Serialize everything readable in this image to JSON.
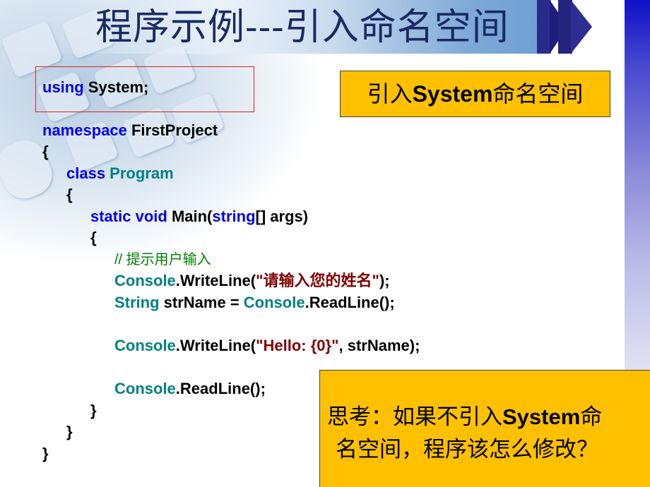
{
  "slide": {
    "title": "程序示例---引入命名空间",
    "callouts": {
      "import_note": {
        "prefix": "引入",
        "keyword": "System",
        "suffix": "命名空间"
      },
      "question": {
        "line1_prefix": "思考：如果不引入",
        "line1_keyword": "System",
        "line1_suffix": "命",
        "line2": "名空间，程序该怎么修改？"
      }
    },
    "code": {
      "using_kw": "using",
      "using_rest": " System;",
      "namespace_kw": "namespace",
      "namespace_name": " FirstProject",
      "open_brace": "{",
      "close_brace": "}",
      "class_kw": "class",
      "class_name": " Program",
      "static_kw": "static",
      "void_kw": " void",
      "main_sig": " Main(",
      "string_kw": "string",
      "main_args": "[] args)",
      "comment": "// 提示用户输入",
      "console": "Console",
      "writeline_open": ".WriteLine(",
      "prompt_str": "\"请输入您的姓名\"",
      "close_stmt": ");",
      "String_type": "String",
      "strname_assign": " strName = ",
      "readline_call": ".ReadLine();",
      "hello_str": "\"Hello: {0}\"",
      "hello_rest": ", strName);"
    }
  }
}
